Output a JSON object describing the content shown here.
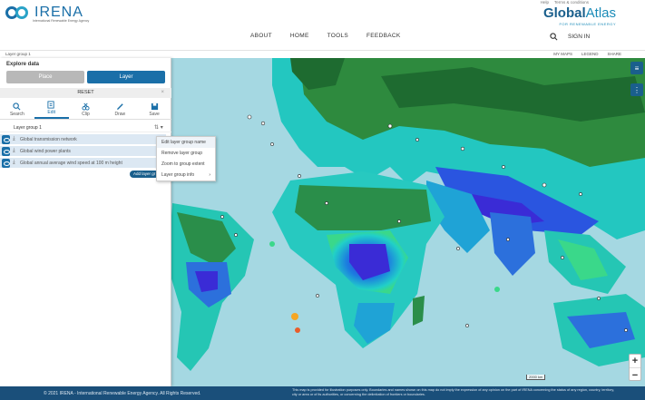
{
  "header": {
    "logo_text": "IRENA",
    "logo_sub": "International Renewable Energy Agency",
    "top_links": [
      "Help",
      "Terms & conditions"
    ],
    "brand_bold": "Global",
    "brand_light": "Atlas",
    "brand_sub": "FOR RENEWABLE ENERGY",
    "nav": [
      "ABOUT",
      "HOME",
      "TOOLS",
      "FEEDBACK"
    ],
    "signin": "SIGN IN"
  },
  "toolbar": {
    "crumb": "Layer group 1",
    "tools": [
      "MY MAPS",
      "LEGEND",
      "SHARE"
    ]
  },
  "panel": {
    "title": "Explore data",
    "place_label": "Place",
    "layer_label": "Layer",
    "reset_label": "RESET",
    "reset_close": "×",
    "tabs": [
      {
        "label": "Search",
        "icon": "search-icon"
      },
      {
        "label": "Edit",
        "icon": "edit-icon"
      },
      {
        "label": "Clip",
        "icon": "clip-icon"
      },
      {
        "label": "Draw",
        "icon": "draw-icon"
      },
      {
        "label": "Save",
        "icon": "save-icon"
      }
    ],
    "group_label": "Layer group 1",
    "layers": [
      "Global transmission network",
      "Global wind power plants",
      "Global annual average wind speed at 100 m height"
    ],
    "add_button": "Add layer gr"
  },
  "context_menu": [
    {
      "label": "Edit layer group name"
    },
    {
      "label": "Remove layer group"
    },
    {
      "label": "Zoom to group extent"
    },
    {
      "label": "Layer group info",
      "arrow": "›"
    }
  ],
  "map": {
    "zoom_in": "+",
    "zoom_out": "−",
    "scale": "2000 km"
  },
  "footer": {
    "copyright": "© 2021 IRENA - International Renewable Energy Agency. All Rights Reserved.",
    "disclaimer": "This map is provided for illustration purposes only. Boundaries and names shown on this map do not imply the expression of any opinion on the part of IRENA concerning the status of any region, country, territory, city or area or of its authorities, or concerning the delimitation of frontiers or boundaries."
  },
  "colors": {
    "primary": "#1a6fa8",
    "dark": "#1a4f7a",
    "ocean": "#a5d8e2"
  }
}
